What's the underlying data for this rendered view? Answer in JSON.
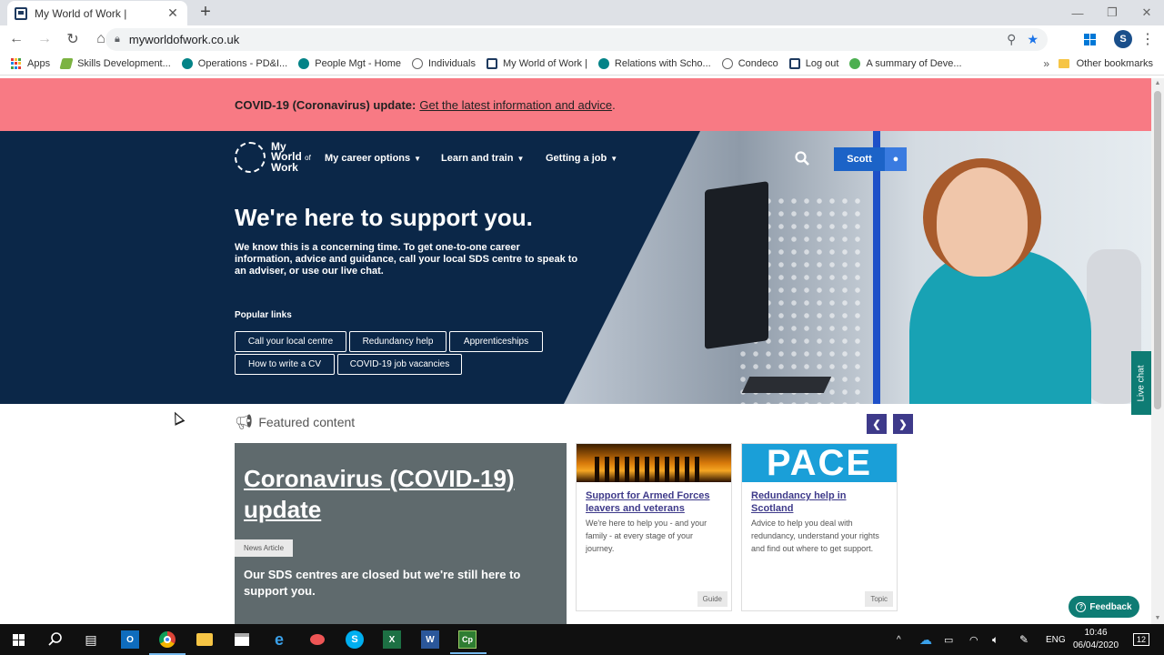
{
  "browser": {
    "tab_title": "My World of Work |",
    "url": "myworldofwork.co.uk",
    "profile_initial": "S",
    "bookmarks": [
      {
        "label": "Apps",
        "icon": "apps-grid-icon"
      },
      {
        "label": "Skills Development...",
        "icon": "sds-icon"
      },
      {
        "label": "Operations - PD&I...",
        "icon": "sharepoint-icon"
      },
      {
        "label": "People Mgt - Home",
        "icon": "sharepoint-icon"
      },
      {
        "label": "Individuals",
        "icon": "globe-icon"
      },
      {
        "label": "My World of Work |",
        "icon": "mwow-icon"
      },
      {
        "label": "Relations with Scho...",
        "icon": "sharepoint-icon"
      },
      {
        "label": "Condeco",
        "icon": "globe-icon"
      },
      {
        "label": "Log out",
        "icon": "mwow-icon"
      },
      {
        "label": "A summary of Deve...",
        "icon": "education-icon"
      }
    ],
    "bookmarks_more": "»",
    "other_bookmarks": "Other bookmarks"
  },
  "banner": {
    "prefix": "COVID-19 (Coronavirus) update:",
    "link": "Get the latest information and advice",
    "suffix": "."
  },
  "header": {
    "logo_line1": "My",
    "logo_line2": "World",
    "logo_of": "of",
    "logo_line3": "Work",
    "nav": [
      "My career options",
      "Learn and train",
      "Getting a job"
    ],
    "user_name": "Scott"
  },
  "hero": {
    "title": "We're here to support you.",
    "lead": "We know this is a concerning time. To get one-to-one career information, advice and guidance, call your local SDS centre to speak to an adviser, or use our live chat.",
    "popular_label": "Popular links",
    "links": [
      "Call your local centre",
      "Redundancy help",
      "Apprenticeships",
      "How to write a CV",
      "COVID-19 job vacancies"
    ]
  },
  "featured": {
    "heading": "Featured content",
    "main": {
      "title": "Coronavirus (COVID-19) update",
      "tag": "News Article",
      "summary": "Our SDS centres are closed but we're still here to support you."
    },
    "cards": [
      {
        "title": "Support for Armed Forces leavers and veterans",
        "desc": "We're here to help you - and your family - at every stage of your journey.",
        "label": "Guide",
        "image": "armed-forces-silhouettes"
      },
      {
        "title": "Redundancy help in Scotland",
        "desc": "Advice to help you deal with redundancy, understand your rights and find out where to get support.",
        "label": "Topic",
        "image_text": "PACE"
      }
    ]
  },
  "widgets": {
    "live_chat": "Live chat",
    "feedback": "Feedback"
  },
  "taskbar": {
    "language": "ENG",
    "time": "10:46",
    "date": "06/04/2020",
    "notifications": "12"
  },
  "colors": {
    "banner": "#f87a84",
    "hero_bg": "#0b2748",
    "accent": "#3e3a8a",
    "user_button": "#1c63c7",
    "teal": "#0e7c74"
  }
}
